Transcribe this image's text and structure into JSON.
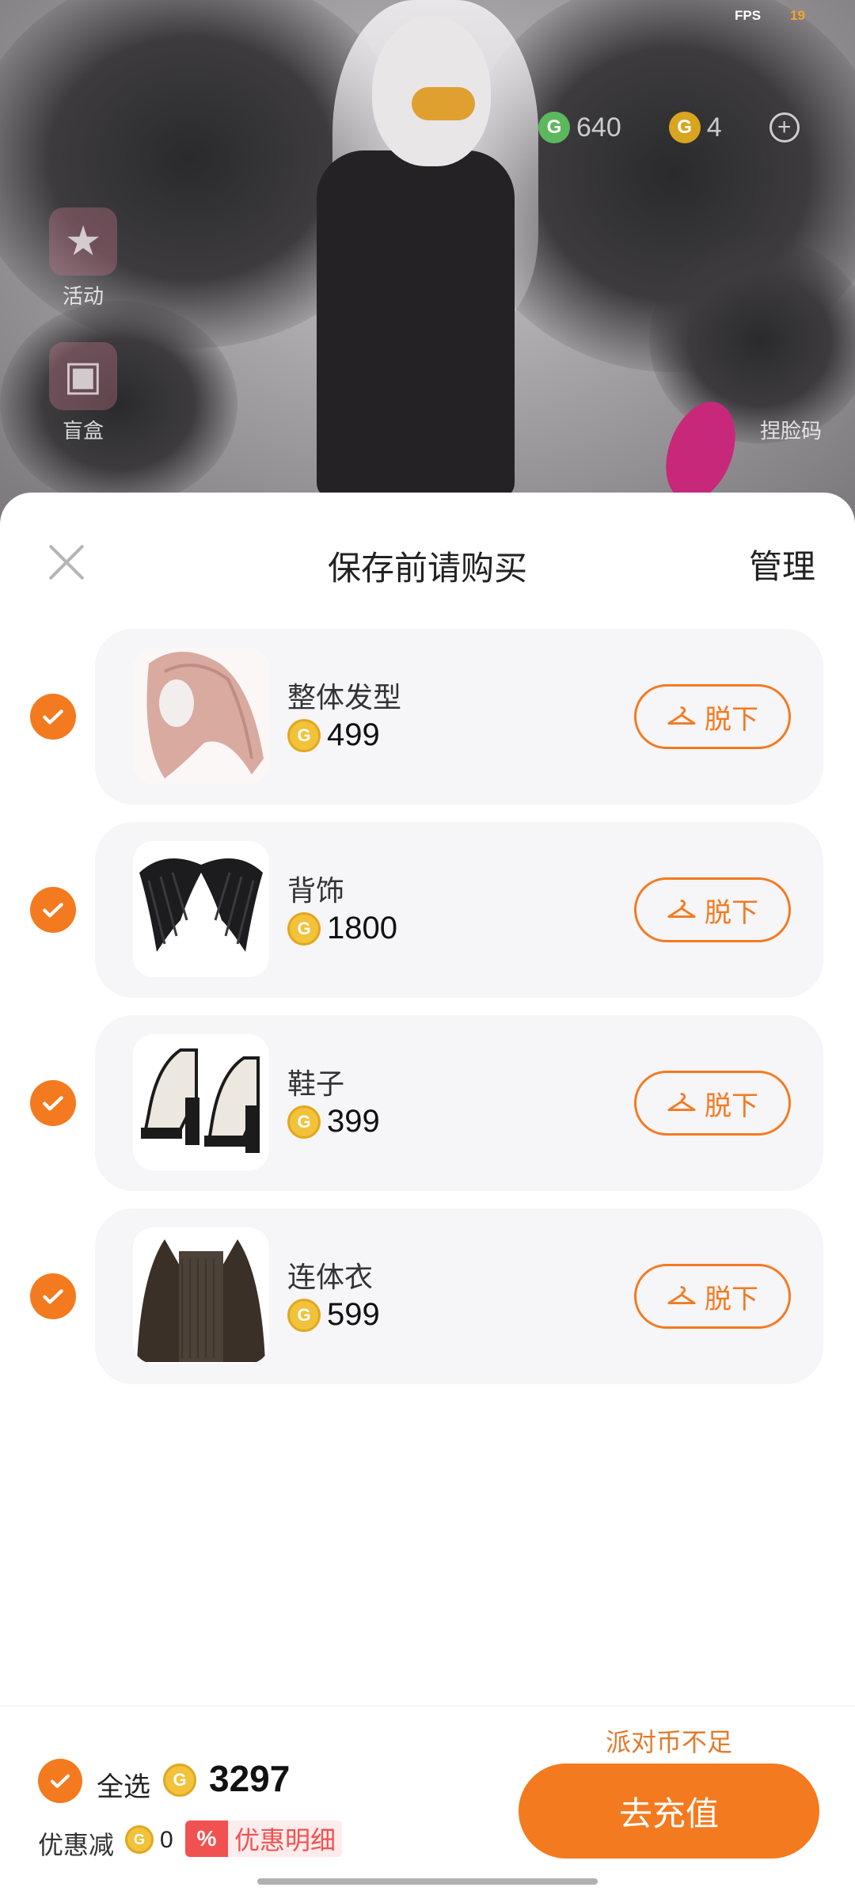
{
  "status": {
    "fps_label": "FPS",
    "fps_value": "19"
  },
  "wallet": {
    "green_coin": "640",
    "gold_coin": "4",
    "green_icon": "g-coin-icon",
    "gold_icon": "gold-coin-icon"
  },
  "side": {
    "activity_label": "活动",
    "blindbox_label": "盲盒",
    "face_label": "捏脸码"
  },
  "sheet": {
    "title": "保存前请购买",
    "manage_label": "管理",
    "takeoff_label": "脱下",
    "items": [
      {
        "name": "整体发型",
        "price": "499"
      },
      {
        "name": "背饰",
        "price": "1800"
      },
      {
        "name": "鞋子",
        "price": "399"
      },
      {
        "name": "连体衣",
        "price": "599"
      }
    ]
  },
  "footer": {
    "insufficient": "派对币不足",
    "select_all": "全选",
    "total": "3297",
    "discount_label": "优惠减",
    "discount_value": "0",
    "pct_badge": "%",
    "discount_detail": "优惠明细",
    "recharge_label": "去充值"
  },
  "colors": {
    "accent": "#f47a1f",
    "coin": "#f2c23a",
    "discount": "#f25151"
  }
}
